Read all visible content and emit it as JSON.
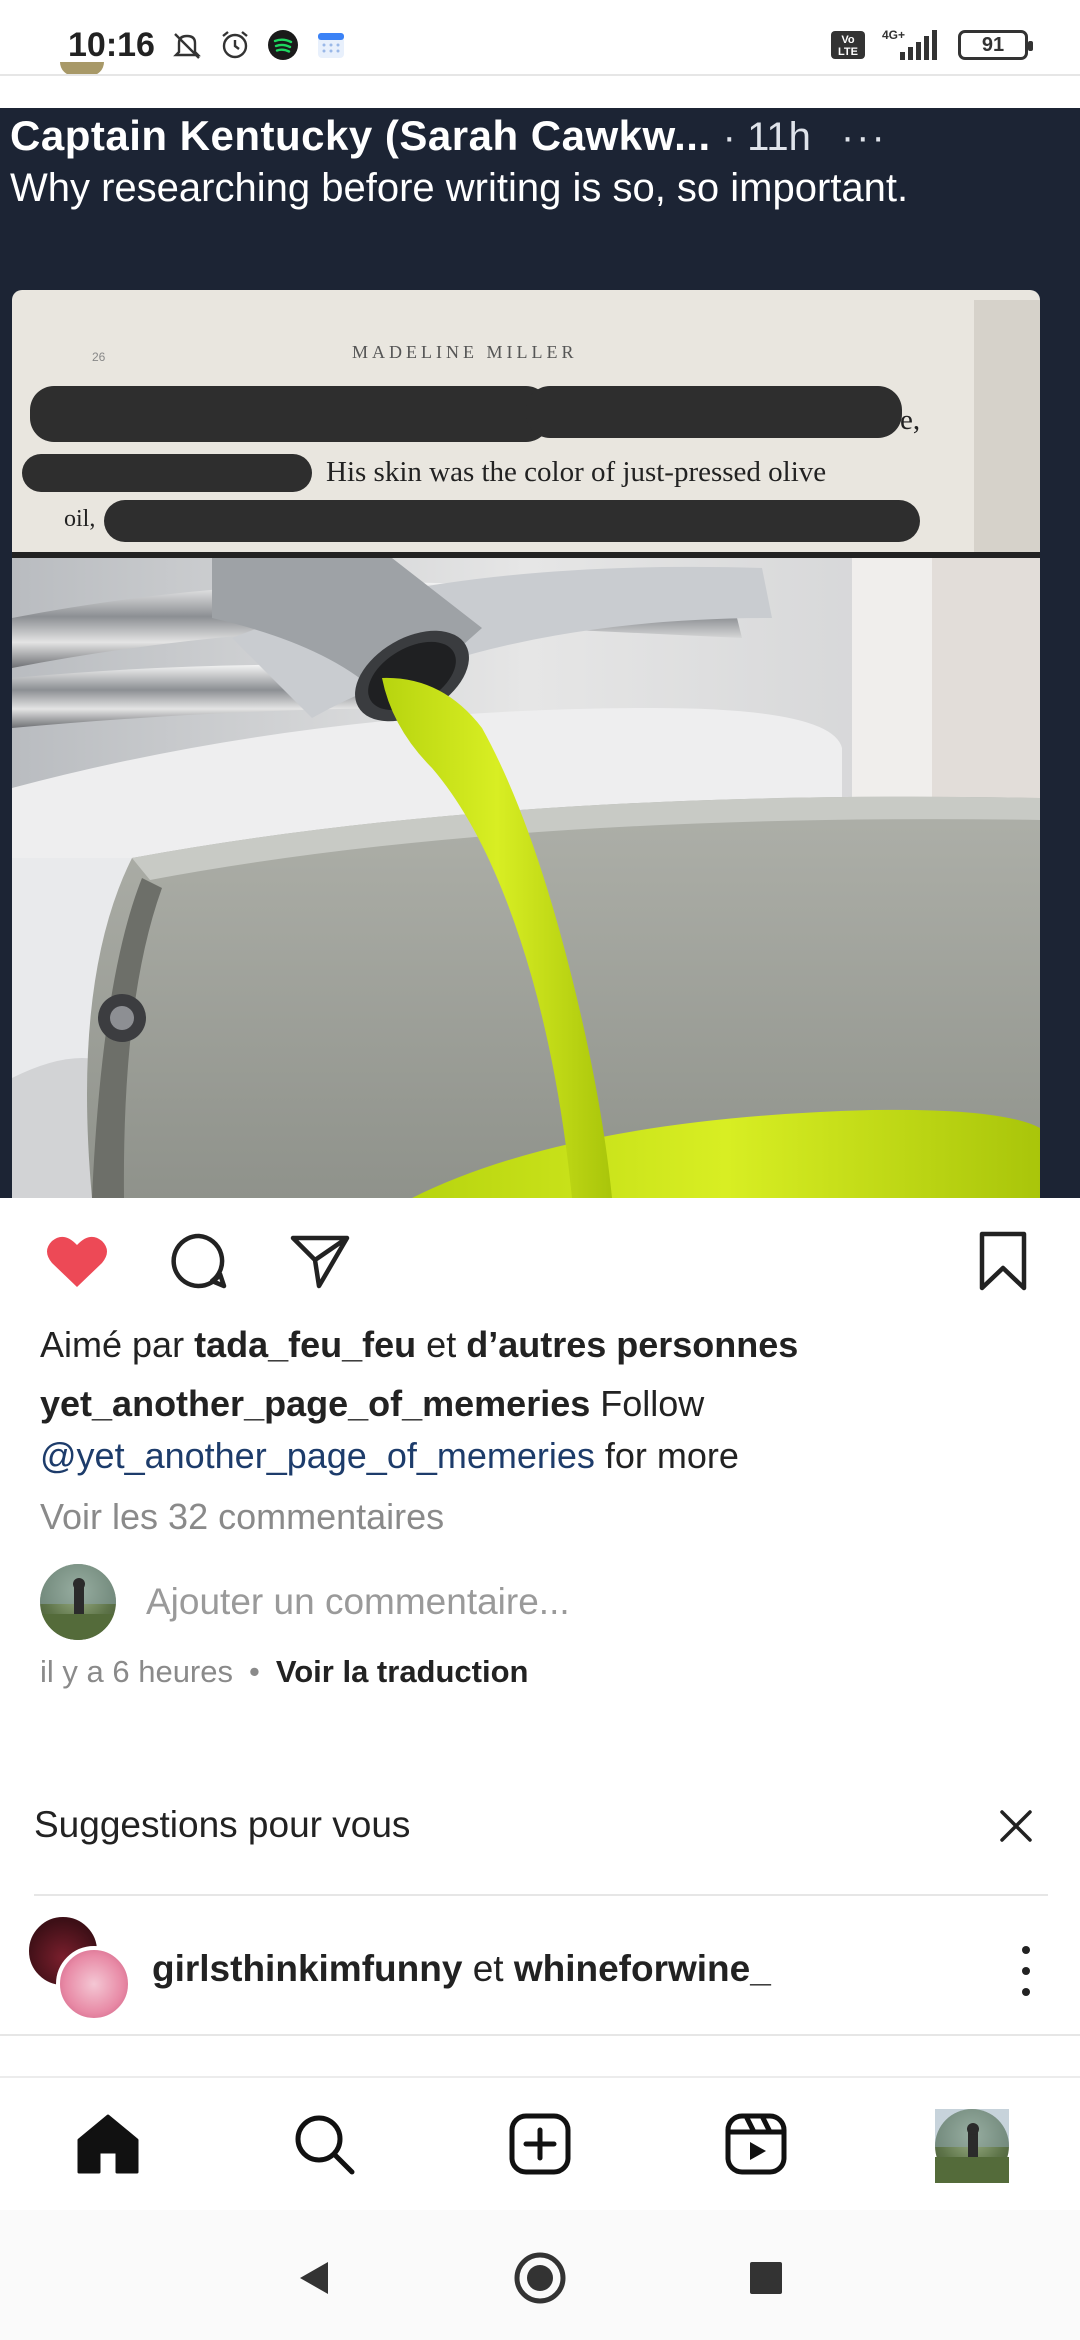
{
  "status_bar": {
    "time": "10:16",
    "battery": "91",
    "network": "4G+",
    "volte": "Vo LTE"
  },
  "post": {
    "author": "Captain Kentucky (Sarah Cawkw...",
    "time": "· 11h",
    "more": "···",
    "text": "Why researching before writing is so, so important.",
    "book": {
      "header": "MADELINE MILLER",
      "page_num": "26",
      "line_end": "e,",
      "line_main": "His skin was the color of just-pressed olive",
      "line_oil": "oil,"
    }
  },
  "actions": {
    "like_icon": "heart-filled-icon",
    "comment_icon": "comment-icon",
    "share_icon": "send-icon",
    "save_icon": "bookmark-icon",
    "like_color": "#ed4956"
  },
  "likes": {
    "prefix": "Aimé par",
    "user": "tada_feu_feu",
    "middle": "et",
    "others": "d’autres personnes"
  },
  "caption": {
    "username": "yet_another_page_of_memeries",
    "text1": "Follow",
    "mention": "@yet_another_page_of_memeries",
    "text2": "for more"
  },
  "view_comments": "Voir les 32 commentaires",
  "comment_placeholder": "Ajouter un commentaire...",
  "meta": {
    "time": "il y a 6 heures",
    "dot": "•",
    "translate": "Voir la traduction"
  },
  "suggestions": {
    "title": "Suggestions pour vous",
    "user1": "girlsthinkimfunny",
    "joiner": "et",
    "user2": "whineforwine_"
  },
  "bottom_nav": [
    "home-icon",
    "search-icon",
    "create-icon",
    "reels-icon",
    "profile-avatar"
  ]
}
